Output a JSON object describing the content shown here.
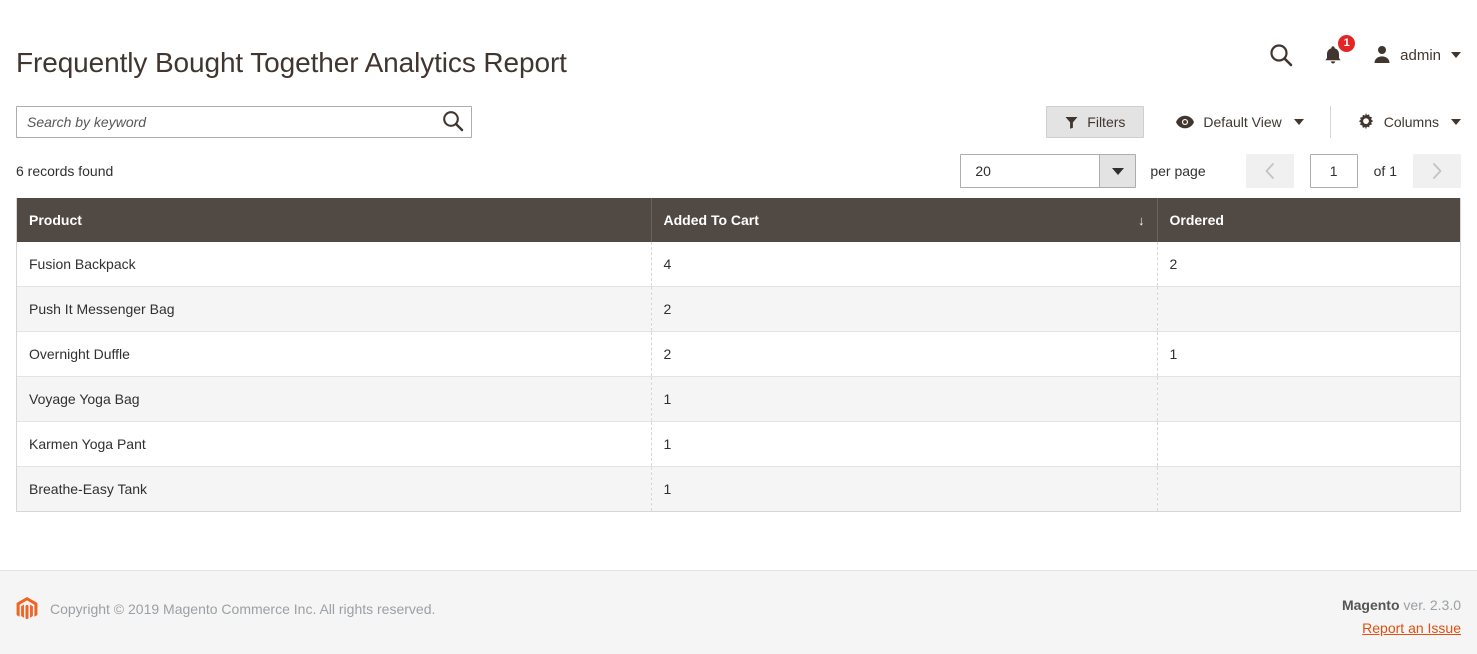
{
  "header": {
    "title": "Frequently Bought Together Analytics Report",
    "search_icon": "search-icon",
    "notifications_icon": "bell-icon",
    "notifications_count": "1",
    "user_icon": "user-avatar-icon",
    "user_name": "admin"
  },
  "toolbar": {
    "search": {
      "placeholder": "Search by keyword",
      "value": "",
      "submit_icon": "search-icon"
    },
    "filters_label": "Filters",
    "filters_icon": "funnel-icon",
    "view_label": "Default View",
    "view_icon": "eye-icon",
    "columns_label": "Columns",
    "columns_icon": "gear-icon"
  },
  "subtoolbar": {
    "records_found": "6 records found",
    "per_page_value": "20",
    "per_page_label": "per page",
    "prev_icon": "chevron-left-icon",
    "next_icon": "chevron-right-icon",
    "current_page": "1",
    "pages_total": "of 1"
  },
  "grid": {
    "columns": [
      {
        "label": "Product",
        "sort": ""
      },
      {
        "label": "Added To Cart",
        "sort": "↓"
      },
      {
        "label": "Ordered",
        "sort": ""
      }
    ],
    "rows": [
      {
        "product": "Fusion Backpack",
        "added_to_cart": "4",
        "ordered": "2"
      },
      {
        "product": "Push It Messenger Bag",
        "added_to_cart": "2",
        "ordered": ""
      },
      {
        "product": "Overnight Duffle",
        "added_to_cart": "2",
        "ordered": "1"
      },
      {
        "product": "Voyage Yoga Bag",
        "added_to_cart": "1",
        "ordered": ""
      },
      {
        "product": "Karmen Yoga Pant",
        "added_to_cart": "1",
        "ordered": ""
      },
      {
        "product": "Breathe-Easy Tank",
        "added_to_cart": "1",
        "ordered": ""
      }
    ]
  },
  "footer": {
    "logo_icon": "magento-logo-icon",
    "copyright": "Copyright © 2019 Magento Commerce Inc. All rights reserved.",
    "brand": "Magento",
    "version": " ver. 2.3.0",
    "report_link": "Report an Issue"
  },
  "colors": {
    "accent_orange": "#e04f10",
    "header_row": "#514943",
    "badge_red": "#e22626",
    "title_brown": "#41362f"
  }
}
